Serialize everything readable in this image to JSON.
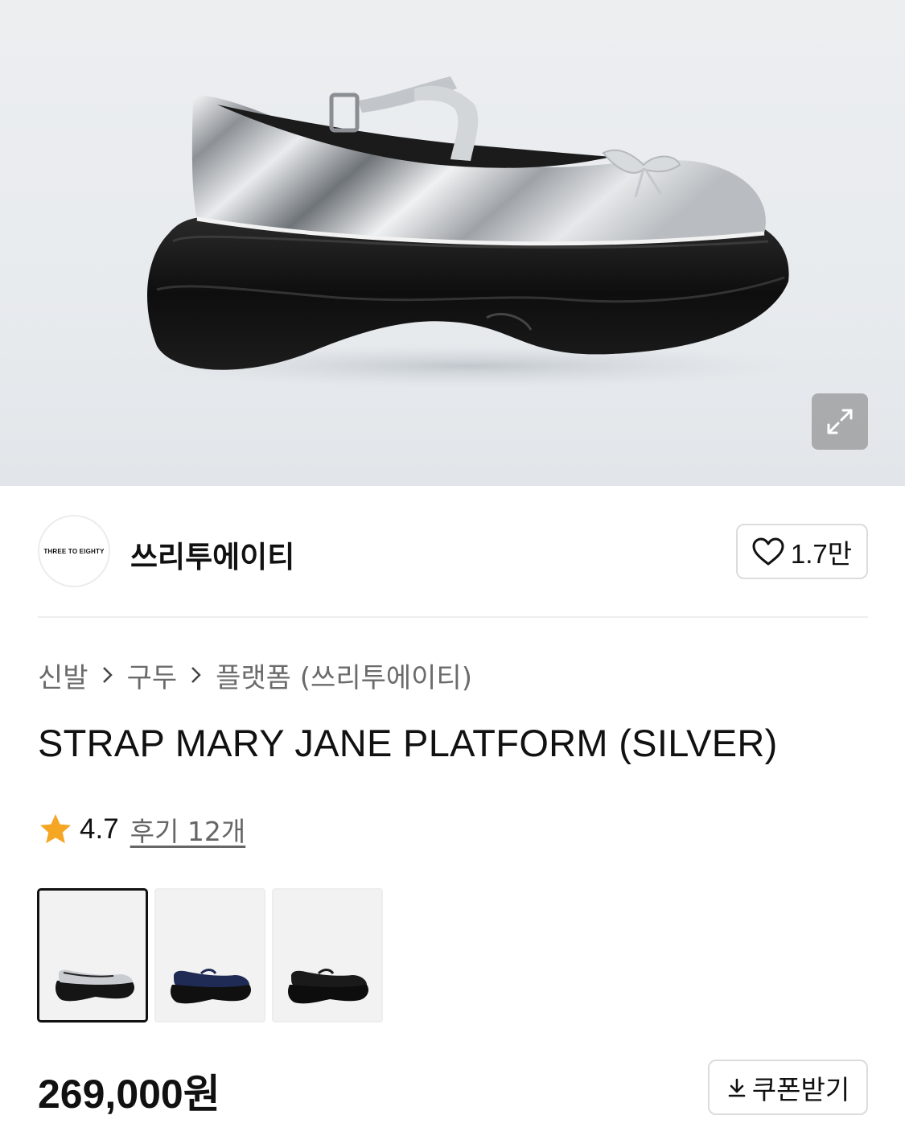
{
  "hero": {
    "image_alt": "STRAP MARY JANE PLATFORM (SILVER)",
    "zoom_icon": "expand-icon"
  },
  "brand": {
    "logo_text": "THREE TO EIGHTY",
    "name": "쓰리투에이티",
    "like_icon": "heart-outline-icon",
    "like_count": "1.7만"
  },
  "breadcrumb": {
    "items": [
      "신발",
      "구두",
      "플랫폼 (쓰리투에이티)"
    ],
    "separator_icon": "chevron-right-icon"
  },
  "product": {
    "title": "STRAP MARY JANE PLATFORM (SILVER)",
    "rating": "4.7",
    "reviews_label": "후기 12개",
    "price": "269,000원"
  },
  "colors": {
    "star": "#f5a623",
    "variants": [
      {
        "upper": "#c9ccd0",
        "sole": "#151515",
        "selected": true
      },
      {
        "upper": "#1f2a55",
        "sole": "#101010",
        "selected": false
      },
      {
        "upper": "#1a1a1a",
        "sole": "#0d0d0d",
        "selected": false
      }
    ]
  },
  "coupon": {
    "icon": "download-icon",
    "label": "쿠폰받기"
  }
}
